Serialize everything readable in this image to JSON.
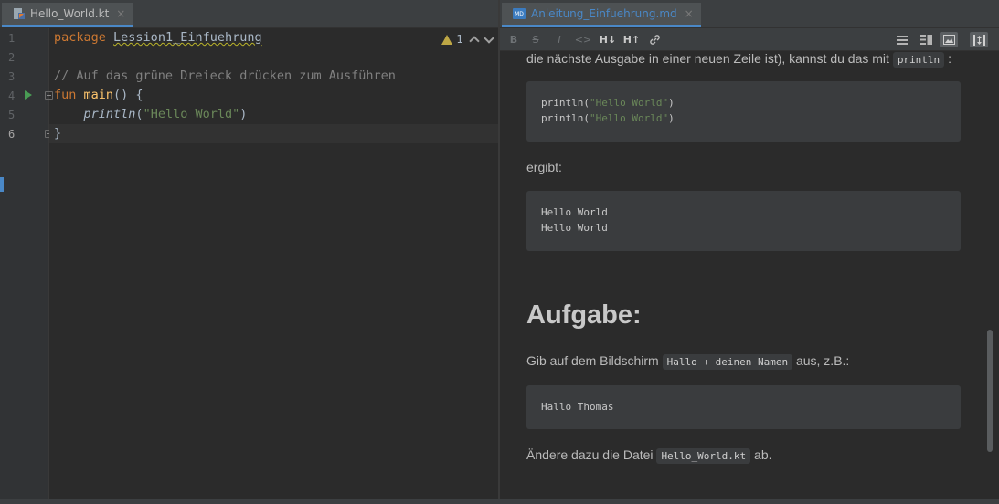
{
  "left_tab": {
    "title": "Hello_World.kt",
    "close": "×"
  },
  "right_tab": {
    "title": "Anleitung_Einfuehrung.md",
    "close": "×",
    "icon_text": "MD"
  },
  "editor": {
    "line_numbers": [
      "1",
      "2",
      "3",
      "4",
      "5",
      "6"
    ],
    "lines": {
      "l1_kw": "package",
      "l1_pkg": "Lession1_Einfuehrung",
      "l3_comment": "// Auf das grüne Dreieck drücken zum Ausführen",
      "l4_kw": "fun",
      "l4_fn": "main",
      "l4_rest": "() {",
      "l5_indent": "    ",
      "l5_call": "println",
      "l5_open": "(",
      "l5_str": "\"Hello World\"",
      "l5_close": ")",
      "l6": "}"
    },
    "inspection_count": "1",
    "icons": [
      "run-gutter-icon",
      "warning-icon",
      "chevron-up-icon",
      "chevron-down-icon",
      "fold-icon"
    ]
  },
  "md_toolbar": {
    "bold": "B",
    "strike": "S",
    "italic": "I",
    "code": "<>",
    "h_down": "H↓",
    "h_up": "H↑",
    "link": "🔗"
  },
  "preview": {
    "para1_text": "die nächste Ausgabe in einer neuen Zeile ist), kannst du das mit",
    "para1_code": "println",
    "para1_end": ":",
    "code1": {
      "line1_call": "println(",
      "line1_str": "\"Hello World\"",
      "line1_end": ")",
      "line2_call": "println(",
      "line2_str": "\"Hello World\"",
      "line2_end": ")"
    },
    "ergibt": "ergibt:",
    "code2": {
      "line1": "Hello World",
      "line2": "Hello World"
    },
    "heading": "Aufgabe:",
    "para2_start": "Gib auf dem Bildschirm",
    "para2_code": "Hallo + deinen Namen",
    "para2_end": "aus, z.B.:",
    "code3": {
      "line1": "Hallo Thomas"
    },
    "para3_start": "Ändere dazu die Datei",
    "para3_code": "Hello_World.kt",
    "para3_end": "ab."
  },
  "colors": {
    "keyword": "#cc7832",
    "function": "#ffc66d",
    "string": "#6a8759",
    "comment": "#808080",
    "accent": "#4a88c7"
  }
}
